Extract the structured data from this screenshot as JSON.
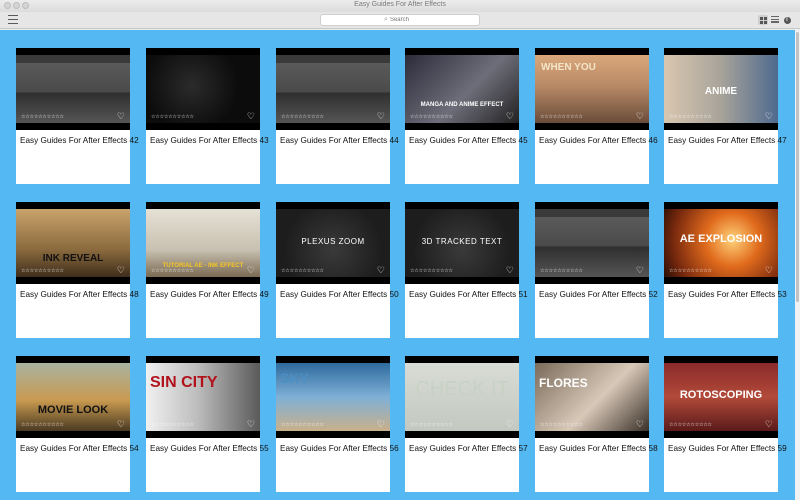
{
  "window": {
    "title": "Easy Guides For After Effects"
  },
  "toolbar": {
    "search_placeholder": "Search"
  },
  "rating_stars": "☆☆☆☆☆☆☆☆☆☆",
  "cards": [
    {
      "title": "Easy Guides For After Effects 42",
      "art": "ae-interface",
      "overlay": ""
    },
    {
      "title": "Easy Guides For After Effects 43",
      "art": "glitch-logo",
      "overlay": ""
    },
    {
      "title": "Easy Guides For After Effects 44",
      "art": "ae-interface",
      "overlay": ""
    },
    {
      "title": "Easy Guides For After Effects 45",
      "art": "manga-anime",
      "overlay": "MANGA AND ANIME EFFECT"
    },
    {
      "title": "Easy Guides For After Effects 46",
      "art": "when-you",
      "overlay": "WHEN YOU"
    },
    {
      "title": "Easy Guides For After Effects 47",
      "art": "anime-color",
      "overlay": "ANIME"
    },
    {
      "title": "Easy Guides For After Effects 48",
      "art": "check-it",
      "overlay": "INK REVEAL"
    },
    {
      "title": "Easy Guides For After Effects 49",
      "art": "ink-effect",
      "overlay": "TUTORIAL AE - INK EFFECT"
    },
    {
      "title": "Easy Guides For After Effects 50",
      "art": "plexus",
      "overlay": "PLEXUS ZOOM"
    },
    {
      "title": "Easy Guides For After Effects 51",
      "art": "tracked-text",
      "overlay": "3D TRACKED TEXT"
    },
    {
      "title": "Easy Guides For After Effects 52",
      "art": "ae-interface",
      "overlay": ""
    },
    {
      "title": "Easy Guides For After Effects 53",
      "art": "explosion",
      "overlay": "AE EXPLOSION"
    },
    {
      "title": "Easy Guides For After Effects 54",
      "art": "movie-look",
      "overlay": "MOVIE LOOK"
    },
    {
      "title": "Easy Guides For After Effects 55",
      "art": "sin-city",
      "overlay": "SIN CITY"
    },
    {
      "title": "Easy Guides For After Effects 56",
      "art": "sky",
      "overlay": "SKY"
    },
    {
      "title": "Easy Guides For After Effects 57",
      "art": "check-it-2",
      "overlay": "CHECK IT"
    },
    {
      "title": "Easy Guides For After Effects 58",
      "art": "flores",
      "overlay": "FLORES"
    },
    {
      "title": "Easy Guides For After Effects 59",
      "art": "rotoscoping",
      "overlay": "ROTOSCOPING"
    }
  ],
  "colors": {
    "background": "#54b8f3",
    "card": "#ffffff"
  }
}
